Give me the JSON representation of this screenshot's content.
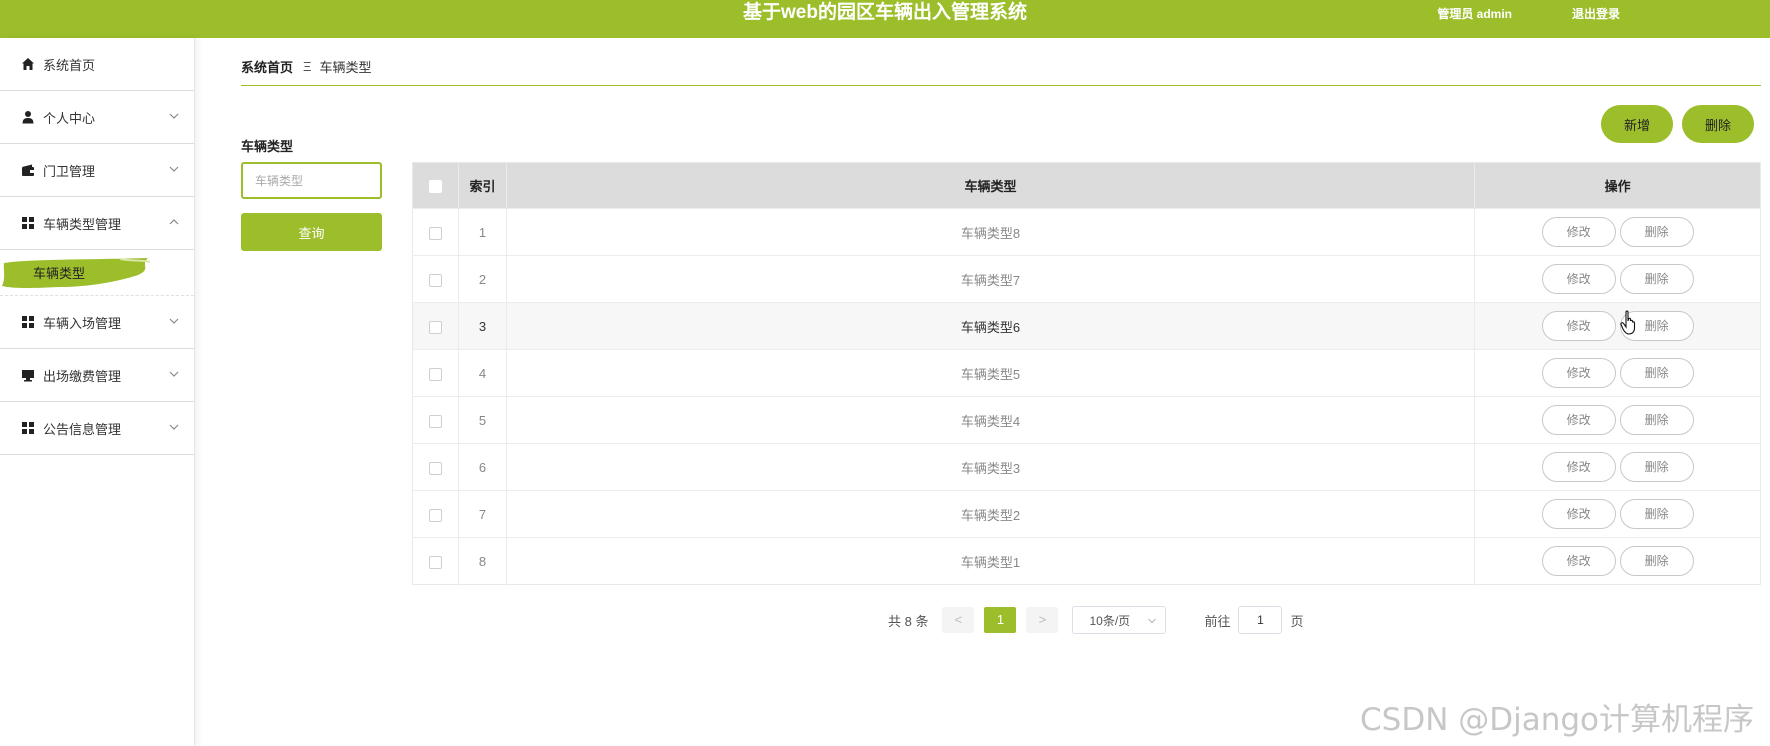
{
  "header": {
    "title": "基于web的园区车辆出入管理系统",
    "user": "管理员 admin",
    "logout": "退出登录"
  },
  "sidebar": {
    "items": [
      {
        "label": "系统首页",
        "icon": "home-icon",
        "expandable": false
      },
      {
        "label": "个人中心",
        "icon": "user-icon",
        "expandable": true,
        "expanded": false
      },
      {
        "label": "门卫管理",
        "icon": "wallet-icon",
        "expandable": true,
        "expanded": false
      },
      {
        "label": "车辆类型管理",
        "icon": "grid-icon",
        "expandable": true,
        "expanded": true
      },
      {
        "label": "车辆入场管理",
        "icon": "grid-icon",
        "expandable": true,
        "expanded": false
      },
      {
        "label": "出场缴费管理",
        "icon": "monitor-icon",
        "expandable": true,
        "expanded": false
      },
      {
        "label": "公告信息管理",
        "icon": "grid-icon",
        "expandable": true,
        "expanded": false
      }
    ],
    "submenu": {
      "label": "车辆类型",
      "active": true
    }
  },
  "breadcrumb": {
    "home": "系统首页",
    "separator": "Ξ",
    "current": "车辆类型"
  },
  "search": {
    "label": "车辆类型",
    "placeholder": "车辆类型",
    "value": "",
    "button": "查询"
  },
  "actions": {
    "add": "新增",
    "delete": "删除"
  },
  "table": {
    "headers": {
      "index": "索引",
      "type": "车辆类型",
      "ops": "操作"
    },
    "edit_label": "修改",
    "delete_label": "删除",
    "rows": [
      {
        "index": "1",
        "type": "车辆类型8"
      },
      {
        "index": "2",
        "type": "车辆类型7"
      },
      {
        "index": "3",
        "type": "车辆类型6"
      },
      {
        "index": "4",
        "type": "车辆类型5"
      },
      {
        "index": "5",
        "type": "车辆类型4"
      },
      {
        "index": "6",
        "type": "车辆类型3"
      },
      {
        "index": "7",
        "type": "车辆类型2"
      },
      {
        "index": "8",
        "type": "车辆类型1"
      }
    ],
    "hover_row": 2
  },
  "pagination": {
    "total": "共 8 条",
    "prev": "<",
    "page": "1",
    "next": ">",
    "page_size": "10条/页",
    "goto_prefix": "前往",
    "goto_value": "1",
    "goto_suffix": "页"
  },
  "watermark": "CSDN @Django计算机程序",
  "colors": {
    "accent": "#9cbe2b",
    "header_bg": "#9cbe2b",
    "table_header_bg": "#dcdcdc"
  }
}
